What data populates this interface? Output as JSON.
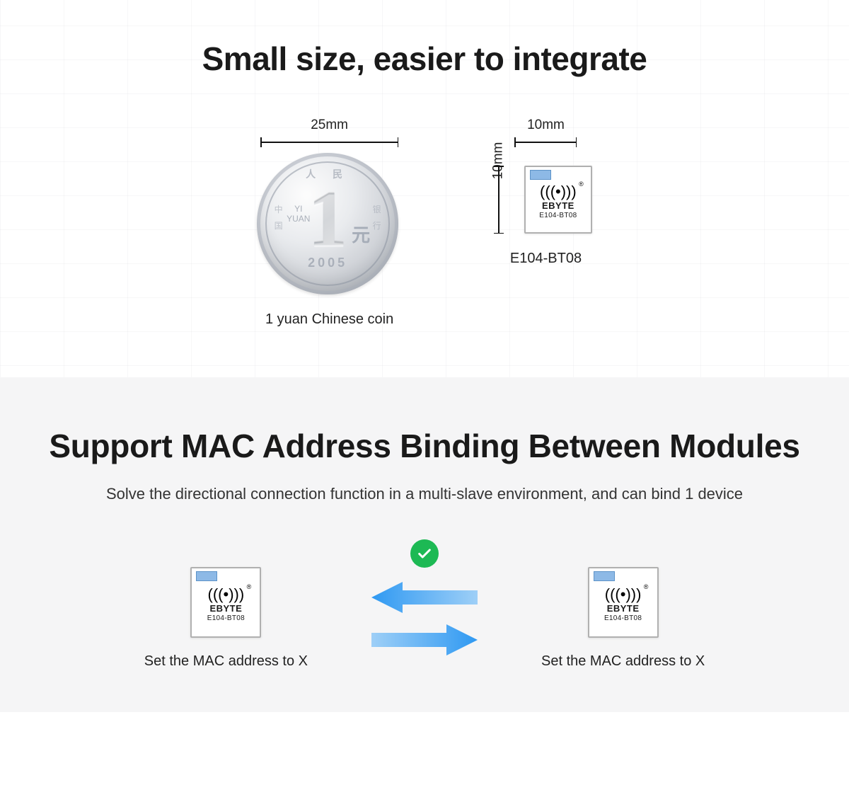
{
  "section1": {
    "title": "Small size, easier to integrate",
    "coin": {
      "width_label": "25mm",
      "topchars": "人 民",
      "sidechar_left": "中 国",
      "sidechar_right": "银 行",
      "yi": "YI",
      "yuan_pinyin": "YUAN",
      "face_number": "1",
      "face_unit": "元",
      "year": "2005",
      "caption": "1 yuan Chinese coin"
    },
    "module": {
      "width_label": "10mm",
      "height_label": "10mm",
      "antenna_glyph": "(((•)))",
      "reg": "®",
      "brand": "EBYTE",
      "model": "E104-BT08",
      "caption": "E104-BT08"
    }
  },
  "section2": {
    "title": "Support MAC Address Binding Between Modules",
    "subtitle": "Solve the directional connection function in a multi-slave environment, and can bind 1 device",
    "left": {
      "caption": "Set the MAC address to X"
    },
    "right": {
      "caption": "Set the MAC address to X"
    },
    "module": {
      "antenna_glyph": "(((•)))",
      "reg": "®",
      "brand": "EBYTE",
      "model": "E104-BT08"
    }
  }
}
